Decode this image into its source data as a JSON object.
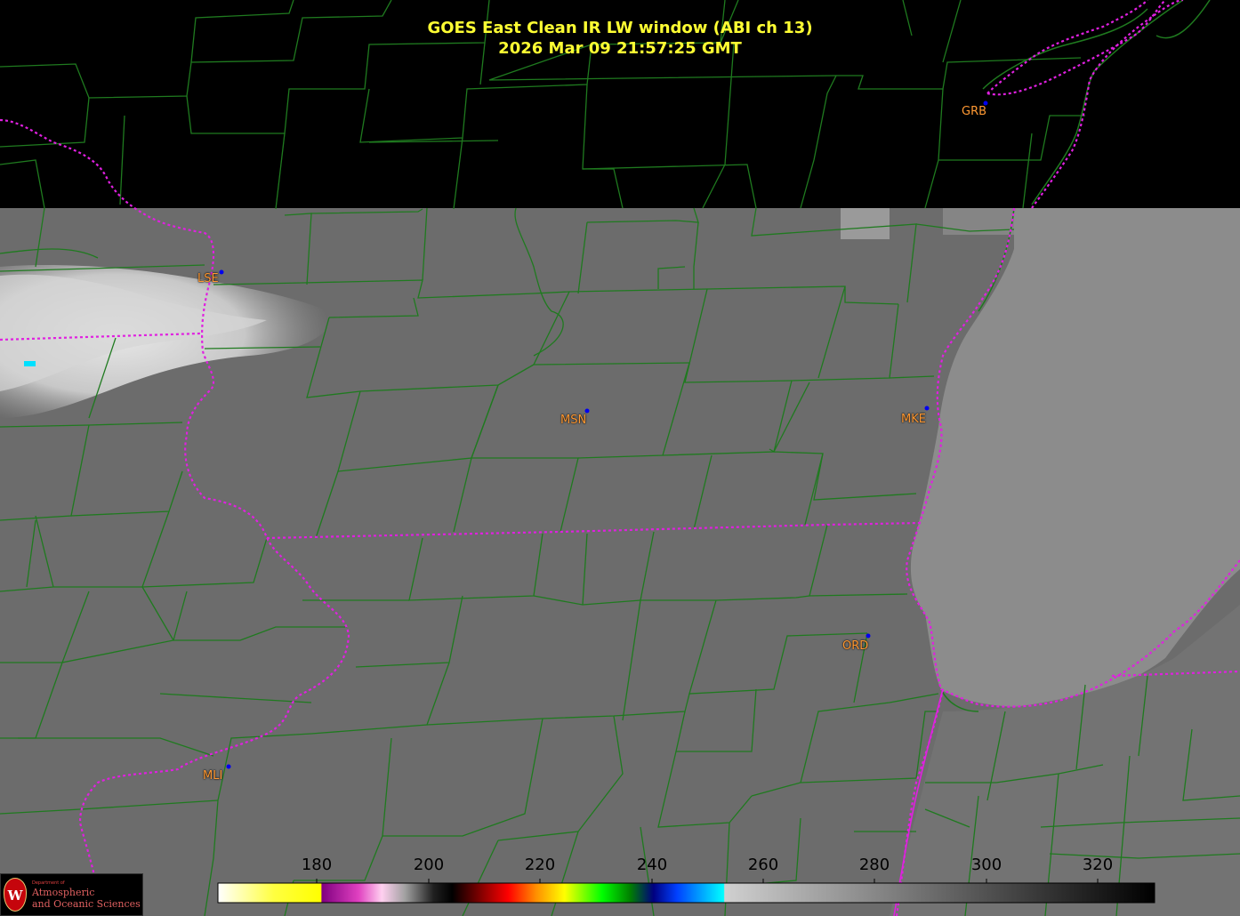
{
  "title": {
    "line1": "GOES East Clean IR LW window (ABI ch 13)",
    "line2": "2026 Mar 09  21:57:25 GMT"
  },
  "stations": [
    {
      "code": "GRB"
    },
    {
      "code": "LSE"
    },
    {
      "code": "MSN"
    },
    {
      "code": "MKE"
    },
    {
      "code": "ORD"
    },
    {
      "code": "MLI"
    }
  ],
  "colorbar": {
    "unit": "",
    "tick_labels": [
      "180",
      "200",
      "220",
      "240",
      "260",
      "280",
      "300",
      "320"
    ],
    "min": 163,
    "max": 330
  },
  "logo": {
    "seal_letter": "W",
    "department_small": "Department of",
    "name_line1": "Atmospheric",
    "name_line2": "and Oceanic Sciences"
  },
  "colors": {
    "state_border": "#e020e0",
    "county_line": "#1f7a1f",
    "title_text": "#ffff33",
    "station_label": "#ff9933",
    "station_dot": "#0000ff",
    "lake": "#8a8a8a",
    "land": "#6a6a6a",
    "cloud": "#d8d8d8"
  }
}
